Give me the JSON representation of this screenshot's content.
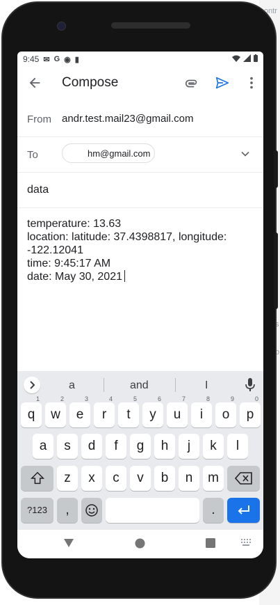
{
  "background": {
    "edge_texts": [
      "ontr",
      "s",
      "b"
    ]
  },
  "status_bar": {
    "time": "9:45",
    "icons": [
      "mail-icon",
      "g-icon",
      "play-protect-icon",
      "sd-card-icon"
    ],
    "right_icons": [
      "wifi-icon",
      "signal-icon",
      "battery-icon"
    ]
  },
  "app_bar": {
    "title": "Compose",
    "actions": [
      "attach-icon",
      "send-icon",
      "more-vert-icon"
    ],
    "accent_color": "#1a73e8"
  },
  "from": {
    "label": "From",
    "value": "andr.test.mail23@gmail.com"
  },
  "to": {
    "label": "To",
    "chip": "hm@gmail.com"
  },
  "subject": {
    "value": "data"
  },
  "body": {
    "lines": [
      "temperature: 13.63",
      "location: latitude: 37.4398817, longitude:",
      "-122.12041",
      "time: 9:45:17 AM",
      "date: May 30, 2021"
    ]
  },
  "keyboard": {
    "suggestions": [
      "a",
      "and",
      "I"
    ],
    "row1": [
      "q",
      "w",
      "e",
      "r",
      "t",
      "y",
      "u",
      "i",
      "o",
      "p"
    ],
    "row1_numbers": [
      "1",
      "2",
      "3",
      "4",
      "5",
      "6",
      "7",
      "8",
      "9",
      "0"
    ],
    "row2": [
      "a",
      "s",
      "d",
      "f",
      "g",
      "h",
      "j",
      "k",
      "l"
    ],
    "row3": [
      "z",
      "x",
      "c",
      "v",
      "b",
      "n",
      "m"
    ],
    "symbols_key": "?123",
    "comma_key": ",",
    "period_key": ".",
    "enter_color": "#1a73e8"
  }
}
